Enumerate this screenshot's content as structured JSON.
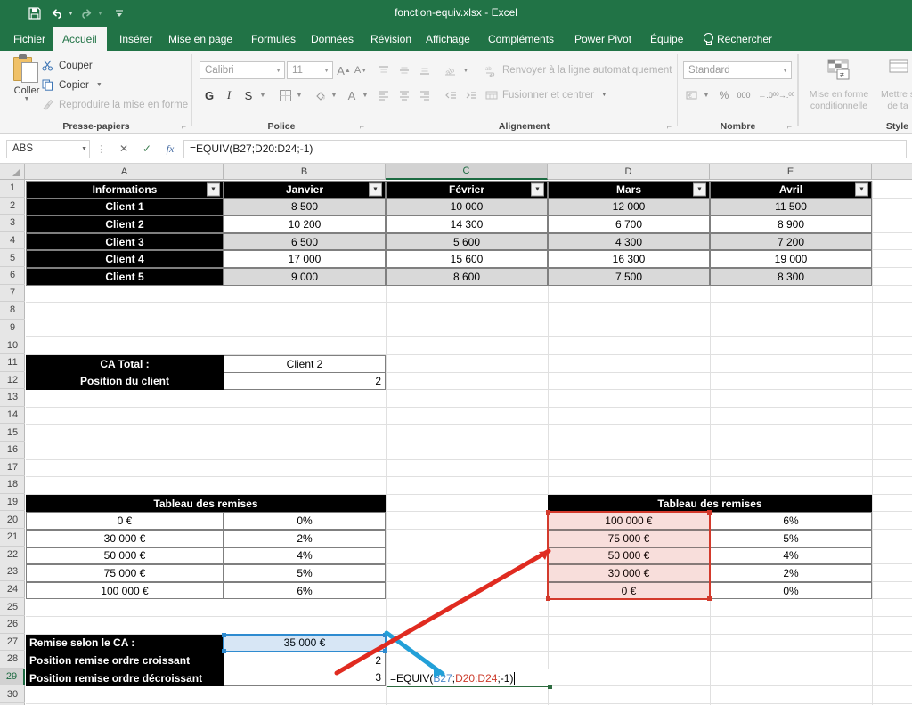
{
  "window": {
    "title": "fonction-equiv.xlsx  -  Excel",
    "quick_access": [
      {
        "name": "save-icon",
        "glyph": "💾"
      },
      {
        "name": "undo-icon",
        "glyph": "↶"
      },
      {
        "name": "redo-icon",
        "glyph": "↷"
      },
      {
        "name": "customize-qat-icon",
        "glyph": "‣"
      }
    ]
  },
  "ribbon": {
    "tabs": [
      {
        "label": "Fichier",
        "active": false
      },
      {
        "label": "Accueil",
        "active": true
      },
      {
        "label": "Insérer",
        "active": false
      },
      {
        "label": "Mise en page",
        "active": false
      },
      {
        "label": "Formules",
        "active": false
      },
      {
        "label": "Données",
        "active": false
      },
      {
        "label": "Révision",
        "active": false
      },
      {
        "label": "Affichage",
        "active": false
      },
      {
        "label": "Compléments",
        "active": false
      },
      {
        "label": "Power Pivot",
        "active": false
      },
      {
        "label": "Équipe",
        "active": false
      }
    ],
    "search_label": "Rechercher",
    "groups": {
      "clipboard": {
        "label": "Presse-papiers",
        "paste_label": "Coller",
        "cut_label": "Couper",
        "copy_label": "Copier",
        "format_painter_label": "Reproduire la mise en forme"
      },
      "font": {
        "label": "Police",
        "font_name": "Calibri",
        "font_size": "11",
        "grow_label": "A",
        "shrink_label": "A",
        "bold_label": "G",
        "italic_label": "I",
        "underline_label": "S"
      },
      "alignment": {
        "label": "Alignement",
        "wrap_label": "Renvoyer à la ligne automatiquement",
        "merge_label": "Fusionner et centrer"
      },
      "number": {
        "label": "Nombre",
        "format": "Standard",
        "percent_label": "%",
        "thousands_label": "000"
      },
      "styles": {
        "label": "Style",
        "conditional_line1": "Mise en forme",
        "conditional_line2": "conditionnelle",
        "table_line1": "Mettre s",
        "table_line2": "de ta"
      }
    }
  },
  "formula_bar": {
    "name_box": "ABS",
    "cancel_icon": "✕",
    "enter_icon": "✓",
    "function_icon": "fx",
    "formula": "=EQUIV(B27;D20:D24;-1)"
  },
  "grid": {
    "columns": [
      {
        "label": "A",
        "selected": false
      },
      {
        "label": "B",
        "selected": false
      },
      {
        "label": "C",
        "selected": true
      },
      {
        "label": "D",
        "selected": false
      },
      {
        "label": "E",
        "selected": false
      }
    ],
    "rows": [
      "1",
      "2",
      "3",
      "4",
      "5",
      "6",
      "7",
      "8",
      "9",
      "10",
      "11",
      "12",
      "13",
      "14",
      "15",
      "16",
      "17",
      "18",
      "19",
      "20",
      "21",
      "22",
      "23",
      "24",
      "25",
      "26",
      "27",
      "28",
      "29",
      "30"
    ],
    "active_row": "29",
    "filter_icon": "▼"
  },
  "sales_table": {
    "headers": [
      "Informations",
      "Janvier",
      "Février",
      "Mars",
      "Avril"
    ],
    "rows": [
      {
        "label": "Client 1",
        "values": [
          "8 500",
          "10 000",
          "12 000",
          "11 500"
        ]
      },
      {
        "label": "Client 2",
        "values": [
          "10 200",
          "14 300",
          "6 700",
          "8 900"
        ]
      },
      {
        "label": "Client 3",
        "values": [
          "6 500",
          "5 600",
          "4 300",
          "7 200"
        ]
      },
      {
        "label": "Client 4",
        "values": [
          "17 000",
          "15 600",
          "16 300",
          "19 000"
        ]
      },
      {
        "label": "Client 5",
        "values": [
          "9 000",
          "8 600",
          "7 500",
          "8 300"
        ]
      }
    ]
  },
  "client_lookup": {
    "label_total": "CA Total :",
    "value_total": "Client 2",
    "label_position": "Position du client",
    "value_position": "2"
  },
  "discount_table_asc": {
    "title": "Tableau des remises",
    "rows": [
      {
        "amount": "0 €",
        "rate": "0%"
      },
      {
        "amount": "30 000 €",
        "rate": "2%"
      },
      {
        "amount": "50 000 €",
        "rate": "4%"
      },
      {
        "amount": "75 000 €",
        "rate": "5%"
      },
      {
        "amount": "100 000 €",
        "rate": "6%"
      }
    ]
  },
  "discount_table_desc": {
    "title": "Tableau des remises",
    "rows": [
      {
        "amount": "100 000 €",
        "rate": "6%"
      },
      {
        "amount": "75 000 €",
        "rate": "5%"
      },
      {
        "amount": "50 000 €",
        "rate": "4%"
      },
      {
        "amount": "30 000 €",
        "rate": "2%"
      },
      {
        "amount": "0 €",
        "rate": "0%"
      }
    ]
  },
  "discount_result": {
    "label_ca": "Remise selon le CA  :",
    "value_ca": "35 000 €",
    "label_asc": "Position remise ordre croissant",
    "value_asc": "2",
    "label_desc": "Position remise ordre décroissant",
    "value_desc": "3"
  },
  "cell_editor": {
    "prefix": "=EQUIV(",
    "ref1": "B27",
    "sep1": ";",
    "ref2": "D20:D24",
    "suffix": ";-1)"
  },
  "colors": {
    "brand_green": "#217346",
    "ref_blue": "#4a86c8",
    "ref_red": "#cc3b2b",
    "arrow_blue": "#22a0d8",
    "arrow_red": "#e02b20",
    "header_black": "#000000",
    "band_gray": "#d9d9d9"
  }
}
